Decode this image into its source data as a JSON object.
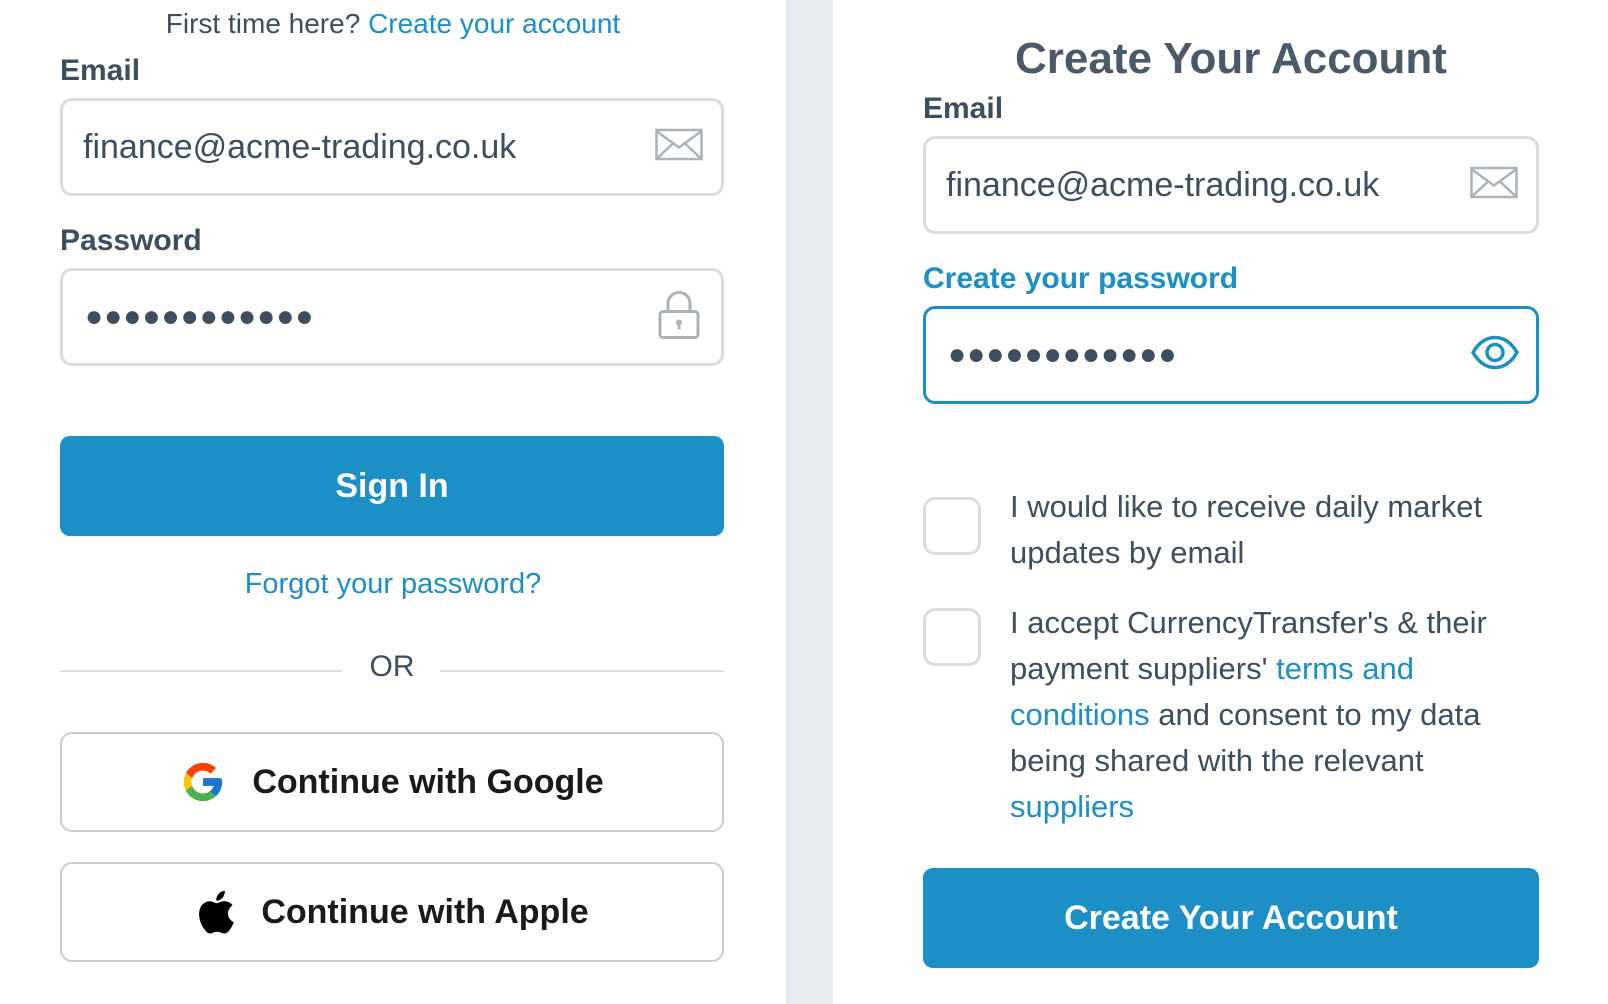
{
  "signin": {
    "first_time_text": "First time here?",
    "create_account_link": "Create your account",
    "email_label": "Email",
    "email_value": "finance@acme-trading.co.uk",
    "password_label": "Password",
    "password_mask": "●●●●●●●●●●●●",
    "sign_in_button": "Sign In",
    "forgot_link": "Forgot your password?",
    "or_text": "OR",
    "google_button": "Continue with Google",
    "apple_button": "Continue with Apple"
  },
  "signup": {
    "title": "Create Your Account",
    "email_label": "Email",
    "email_value": "finance@acme-trading.co.uk",
    "password_label": "Create your password",
    "password_mask": "●●●●●●●●●●●●",
    "checkbox_updates": "I would like to receive daily market updates by email",
    "terms_part1": "I accept CurrencyTransfer's & their payment suppliers'",
    "terms_link": "terms and conditions",
    "terms_part2": "and consent to my data being shared with the relevant",
    "suppliers_link": "suppliers",
    "create_button": "Create Your Account"
  },
  "colors": {
    "accent": "#1b8fc6",
    "text": "#3d4f5f",
    "border": "#d9dde1",
    "divider": "#e8ecf0"
  },
  "icons": [
    "envelope-icon",
    "lock-icon",
    "eye-icon",
    "google-icon",
    "apple-icon"
  ]
}
